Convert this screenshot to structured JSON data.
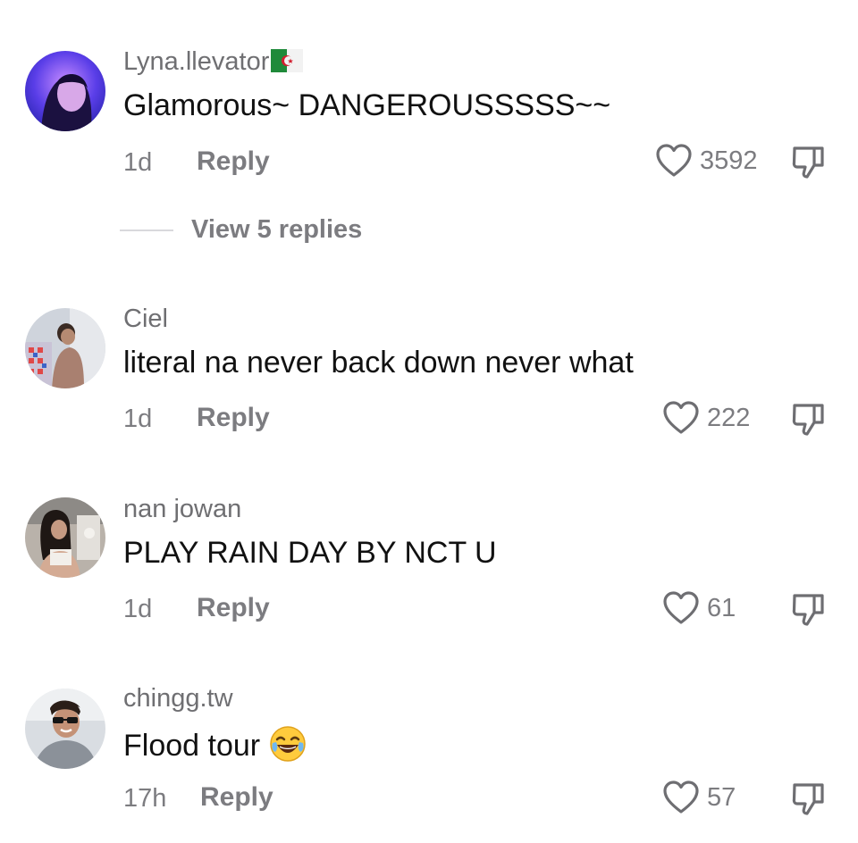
{
  "comments": [
    {
      "username": "Lyna.llevator",
      "text": "Glamorous~ DANGEROUSSSSS~~",
      "time": "1d",
      "reply_label": "Reply",
      "likes": "3592",
      "flag_icon": "algeria-flag-icon"
    },
    {
      "username": "Ciel",
      "text": "literal na never back down never what",
      "time": "1d",
      "reply_label": "Reply",
      "likes": "222"
    },
    {
      "username": "nan jowan",
      "text": "PLAY RAIN DAY BY NCT U",
      "time": "1d",
      "reply_label": "Reply",
      "likes": "61"
    },
    {
      "username": "chingg.tw",
      "text": "Flood tour",
      "time": "17h",
      "reply_label": "Reply",
      "likes": "57",
      "emoji_icon": "tears-of-joy-emoji-icon"
    }
  ],
  "view_replies": {
    "label": "View 5 replies"
  },
  "colors": {
    "meta_text": "#7c7c80",
    "comment_text": "#111111",
    "divider": "#d9d9dc"
  }
}
